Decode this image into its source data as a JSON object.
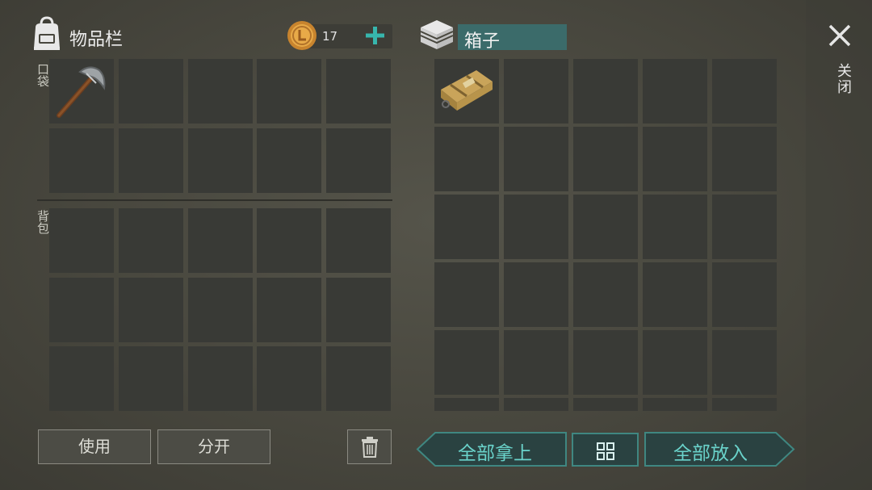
{
  "inventory": {
    "title": "物品栏",
    "coin_count": "17",
    "pocket_label": "口袋",
    "backpack_label": "背包",
    "pocket_items": [
      "pickaxe-icon",
      "",
      "",
      "",
      "",
      "",
      "",
      "",
      "",
      ""
    ],
    "backpack_rows": 3
  },
  "container": {
    "title": "箱子",
    "items": [
      "supply-crate-icon"
    ]
  },
  "close_label": "关闭",
  "buttons": {
    "use": "使用",
    "split": "分开",
    "take_all": "全部拿上",
    "put_all": "全部放入"
  },
  "colors": {
    "accent_teal": "#3f8781",
    "teal_text": "#6ad3cb",
    "title_highlight": "#3b6b6a",
    "slot": "#393a36"
  }
}
